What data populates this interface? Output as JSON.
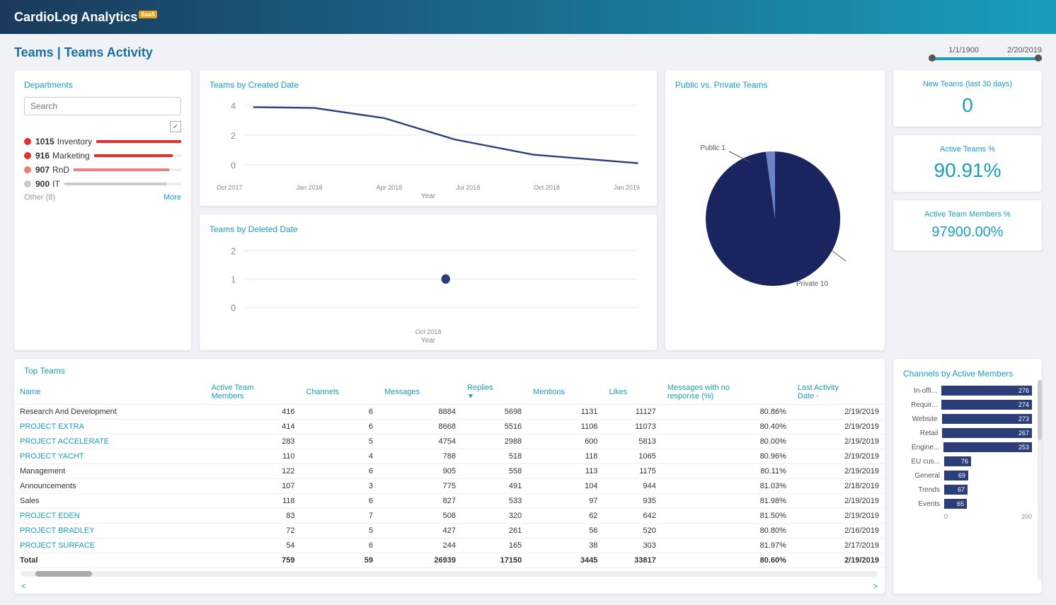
{
  "header": {
    "logo": "CardioLog Analytics",
    "saas_badge": "SaaS"
  },
  "page": {
    "title": "Teams | Teams Activity",
    "date_start": "1/1/1900",
    "date_end": "2/20/2019"
  },
  "departments": {
    "title": "Departments",
    "search_placeholder": "Search",
    "items": [
      {
        "count": "1015",
        "name": "Inventory",
        "color": "#e03030",
        "bar_pct": 100
      },
      {
        "count": "916",
        "name": "Marketing",
        "color": "#e03030",
        "bar_pct": 90
      },
      {
        "count": "907",
        "name": "RnD",
        "color": "#e88080",
        "bar_pct": 89
      },
      {
        "count": "900",
        "name": "IT",
        "color": "#cccccc",
        "bar_pct": 88
      }
    ],
    "other_label": "Other (8)",
    "more_label": "More"
  },
  "teams_by_created": {
    "title": "Teams by Created Date",
    "y_labels": [
      "4",
      "2",
      "0"
    ],
    "x_labels": [
      "Oct 2017",
      "Jan 2018",
      "Apr 2018",
      "Jul 2018",
      "Oct 2018",
      "Jan 2019"
    ],
    "x_title": "Year"
  },
  "teams_by_deleted": {
    "title": "Teams by Deleted Date",
    "y_labels": [
      "2",
      "1",
      "0"
    ],
    "x_labels": [
      "Oct 2018"
    ],
    "x_title": "Year"
  },
  "public_private": {
    "title": "Public vs. Private Teams",
    "public_label": "Public 1",
    "private_label": "Private 10"
  },
  "new_teams": {
    "title": "New Teams (last 30 days)",
    "value": "0"
  },
  "active_teams": {
    "title": "Active Teams %",
    "value": "90.91%"
  },
  "active_members": {
    "title": "Active Team Members %",
    "value": "97900.00%"
  },
  "top_teams": {
    "title": "Top Teams",
    "columns": [
      "Name",
      "Active Team Members",
      "Channels",
      "Messages",
      "Replies",
      "Mentions",
      "Likes",
      "Messages with no response (%)",
      "Last Activity Date"
    ],
    "rows": [
      {
        "name": "Research And Development",
        "atm": "416",
        "ch": "6",
        "msg": "8884",
        "rep": "5698",
        "men": "1131",
        "likes": "11127",
        "noresp": "80.86%",
        "date": "2/19/2019",
        "link": false
      },
      {
        "name": "PROJECT EXTRA",
        "atm": "414",
        "ch": "6",
        "msg": "8668",
        "rep": "5516",
        "men": "1106",
        "likes": "11073",
        "noresp": "80.40%",
        "date": "2/19/2019",
        "link": true
      },
      {
        "name": "PROJECT ACCELERATE",
        "atm": "283",
        "ch": "5",
        "msg": "4754",
        "rep": "2988",
        "men": "600",
        "likes": "5813",
        "noresp": "80.00%",
        "date": "2/19/2019",
        "link": true
      },
      {
        "name": "PROJECT YACHT",
        "atm": "110",
        "ch": "4",
        "msg": "788",
        "rep": "518",
        "men": "118",
        "likes": "1065",
        "noresp": "80.96%",
        "date": "2/19/2019",
        "link": true
      },
      {
        "name": "Management",
        "atm": "122",
        "ch": "6",
        "msg": "905",
        "rep": "558",
        "men": "113",
        "likes": "1175",
        "noresp": "80.11%",
        "date": "2/19/2019",
        "link": false
      },
      {
        "name": "Announcements",
        "atm": "107",
        "ch": "3",
        "msg": "775",
        "rep": "491",
        "men": "104",
        "likes": "944",
        "noresp": "81.03%",
        "date": "2/18/2019",
        "link": false
      },
      {
        "name": "Sales",
        "atm": "118",
        "ch": "6",
        "msg": "827",
        "rep": "533",
        "men": "97",
        "likes": "935",
        "noresp": "81.98%",
        "date": "2/19/2019",
        "link": false
      },
      {
        "name": "PROJECT EDEN",
        "atm": "83",
        "ch": "7",
        "msg": "508",
        "rep": "320",
        "men": "62",
        "likes": "642",
        "noresp": "81.50%",
        "date": "2/19/2019",
        "link": true
      },
      {
        "name": "PROJECT BRADLEY",
        "atm": "72",
        "ch": "5",
        "msg": "427",
        "rep": "261",
        "men": "56",
        "likes": "520",
        "noresp": "80.80%",
        "date": "2/16/2019",
        "link": true
      },
      {
        "name": "PROJECT SURFACE",
        "atm": "54",
        "ch": "6",
        "msg": "244",
        "rep": "165",
        "men": "38",
        "likes": "303",
        "noresp": "81.97%",
        "date": "2/17/2019",
        "link": true
      }
    ],
    "total": {
      "label": "Total",
      "atm": "759",
      "ch": "59",
      "msg": "26939",
      "rep": "17150",
      "men": "3445",
      "likes": "33817",
      "noresp": "80.60%",
      "date": "2/19/2019"
    }
  },
  "channels_by_active": {
    "title": "Channels by Active Members",
    "bars": [
      {
        "label": "In-offi...",
        "value": 276,
        "max": 300
      },
      {
        "label": "Requir...",
        "value": 274,
        "max": 300
      },
      {
        "label": "Website",
        "value": 273,
        "max": 300
      },
      {
        "label": "Retail",
        "value": 267,
        "max": 300
      },
      {
        "label": "Engine...",
        "value": 253,
        "max": 300
      },
      {
        "label": "EU cus...",
        "value": 76,
        "max": 300
      },
      {
        "label": "General",
        "value": 69,
        "max": 300
      },
      {
        "label": "Trends",
        "value": 67,
        "max": 300
      },
      {
        "label": "Events",
        "value": 65,
        "max": 300
      }
    ],
    "axis_labels": [
      "0",
      "200"
    ]
  }
}
